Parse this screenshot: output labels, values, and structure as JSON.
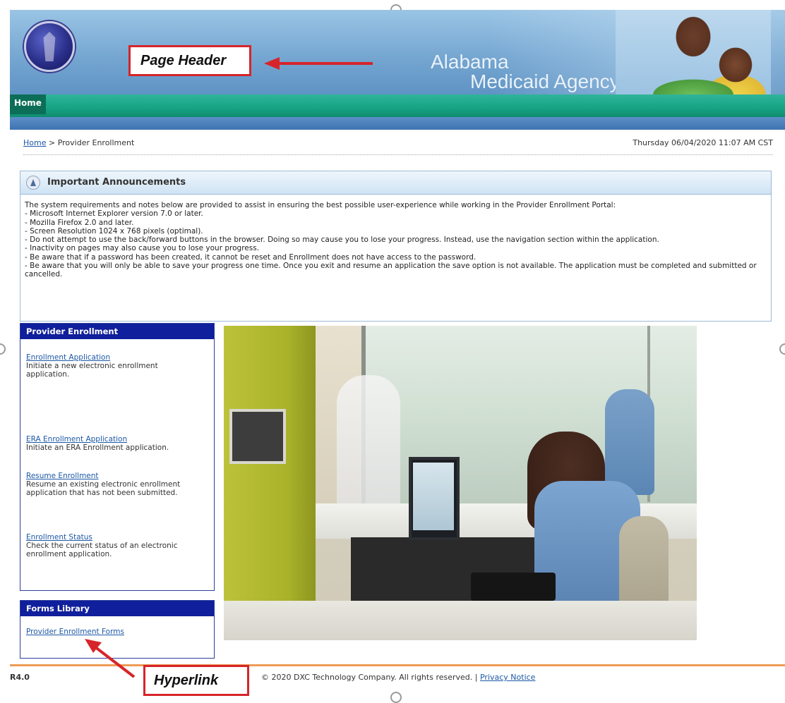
{
  "header": {
    "agency_line1": "Alabama",
    "agency_line2": "Medicaid Agency",
    "seal_icon": "state-seal-icon",
    "photo_icon": "mother-daughter-photo"
  },
  "nav": {
    "home": "Home"
  },
  "breadcrumb": {
    "home": "Home",
    "separator": ">",
    "current": "Provider Enrollment",
    "datetime": "Thursday 06/04/2020 11:07 AM CST"
  },
  "announcements": {
    "title": "Important Announcements",
    "lines": [
      "The system requirements and notes below are provided to assist in ensuring the best possible user-experience while working in the Provider Enrollment Portal:",
      "- Microsoft Internet Explorer version 7.0 or later.",
      "- Mozilla Firefox 2.0 and later.",
      "- Screen Resolution 1024 x 768 pixels (optimal).",
      "- Do not attempt to use the back/forward buttons in the browser. Doing so may cause you to lose your progress. Instead, use the navigation section within the application.",
      "- Inactivity on pages may also cause you to lose your progress.",
      "- Be aware that if a password has been created, it cannot be reset and Enrollment does not have access to the password.",
      "- Be aware that you will only be able to save your progress one time. Once you exit and resume an application the save option is not available. The application must be completed and submitted or cancelled."
    ]
  },
  "provider_enrollment": {
    "title": "Provider Enrollment",
    "items": [
      {
        "link": "Enrollment Application",
        "desc": "Initiate a new electronic enrollment application."
      },
      {
        "link": "ERA Enrollment Application",
        "desc": "Initiate an ERA Enrollment application."
      },
      {
        "link": "Resume Enrollment",
        "desc": "Resume an existing electronic enrollment application that has not been submitted."
      },
      {
        "link": "Enrollment Status",
        "desc": "Check the current status of an electronic enrollment application."
      }
    ]
  },
  "forms_library": {
    "title": "Forms Library",
    "link": "Provider Enrollment Forms"
  },
  "footer": {
    "version": "R4.0",
    "copyright": "© 2020 DXC Technology Company. All rights reserved. |",
    "privacy": "Privacy Notice"
  },
  "callouts": {
    "page_header": "Page Header",
    "hyperlink": "Hyperlink",
    "color": "#d6252a"
  },
  "colors": {
    "nav_green": "#17a384",
    "panel_blue": "#101f9b",
    "link_blue": "#1d58a6",
    "footer_orange": "#ef9b57"
  }
}
